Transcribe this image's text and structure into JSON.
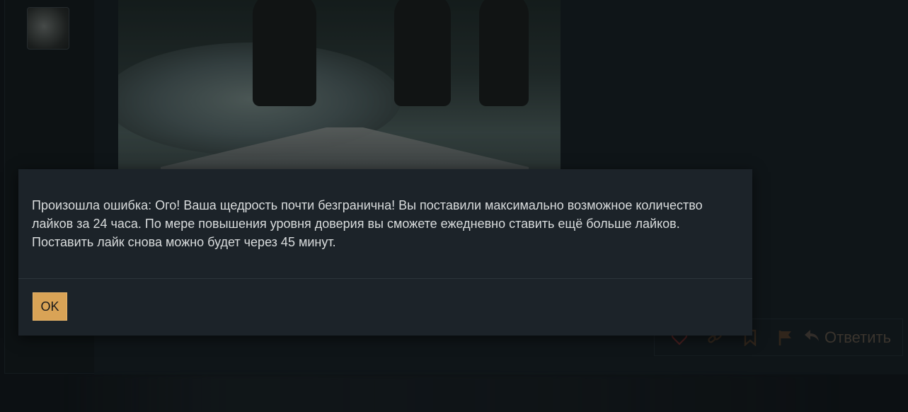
{
  "post": {
    "avatar_alt": "avatar",
    "image": "post-image"
  },
  "actions": {
    "like_icon": "heart-icon",
    "link_icon": "link-icon",
    "bookmark_icon": "bookmark-icon",
    "report_icon": "flag-icon",
    "reply_icon": "reply-arrow-icon",
    "reply_label": "Ответить"
  },
  "modal": {
    "message": "Произошла ошибка: Ого! Ваша щедрость почти безгранична! Вы поставили максимально возможное количество лайков за 24 часа. По мере повышения уровня доверия вы сможете ежедневно ставить ещё больше лайков. Поставить лайк снова можно будет через 45 минут.",
    "ok_label": "OK"
  },
  "colors": {
    "accent": "#d9a356",
    "modal_bg": "#1c2329",
    "page_bg": "#131a1e"
  }
}
